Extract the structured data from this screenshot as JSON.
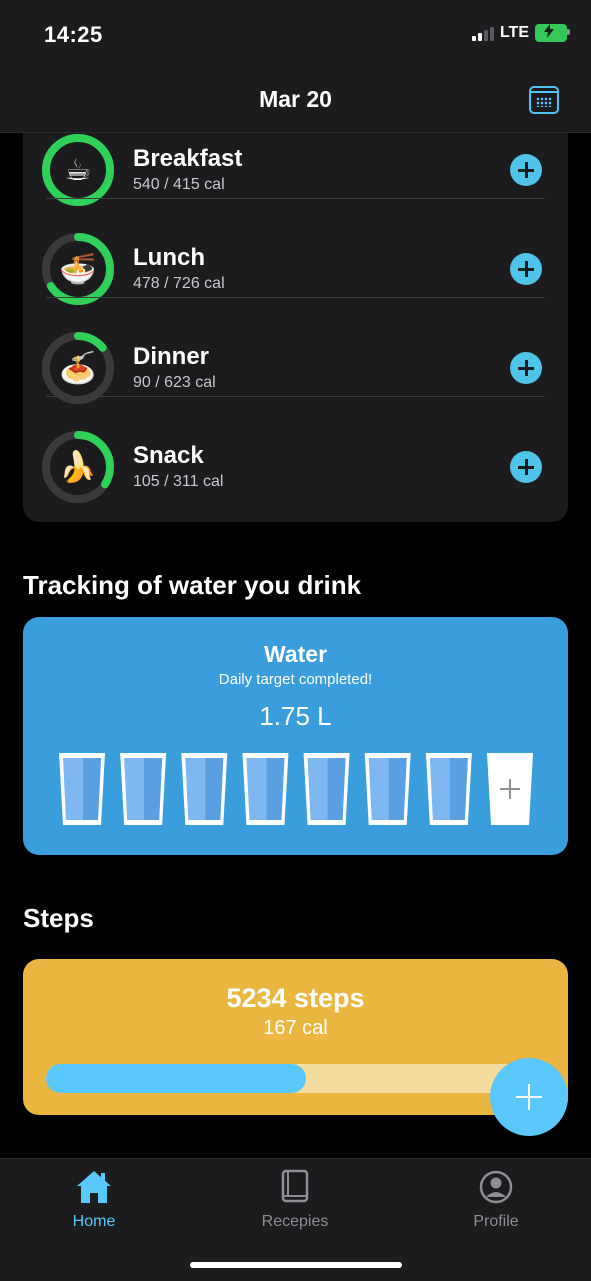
{
  "status_bar": {
    "time": "14:25",
    "network": "LTE"
  },
  "header": {
    "title": "Mar 20",
    "calendar_icon": "calendar-icon"
  },
  "meals": [
    {
      "name": "Breakfast",
      "calories": "540 / 415 cal",
      "progress": 1.0,
      "icon": "coffee-cup-icon",
      "emoji": "☕"
    },
    {
      "name": "Lunch",
      "calories": "478 / 726 cal",
      "progress": 0.66,
      "icon": "noodle-bowl-icon",
      "emoji": "🍜"
    },
    {
      "name": "Dinner",
      "calories": "90 / 623 cal",
      "progress": 0.14,
      "icon": "spaghetti-icon",
      "emoji": "🍝"
    },
    {
      "name": "Snack",
      "calories": "105 / 311 cal",
      "progress": 0.34,
      "icon": "banana-icon",
      "emoji": "🍌"
    }
  ],
  "water_section": {
    "heading": "Tracking of water you drink",
    "title": "Water",
    "subtitle": "Daily target completed!",
    "amount": "1.75 L",
    "glasses_filled": 7,
    "glasses_total": 8
  },
  "steps_section": {
    "heading": "Steps",
    "count": "5234 steps",
    "calories": "167 cal",
    "progress": 0.52
  },
  "tabs": [
    {
      "label": "Home",
      "icon": "home-icon",
      "active": true
    },
    {
      "label": "Recepies",
      "icon": "book-icon",
      "active": false
    },
    {
      "label": "Profile",
      "icon": "profile-icon",
      "active": false
    }
  ],
  "colors": {
    "accent": "#5ac8fa",
    "ring_progress": "#30d158",
    "ring_track": "#3a3a3c",
    "water_card": "#3a9ddc",
    "steps_card": "#ebb740"
  }
}
